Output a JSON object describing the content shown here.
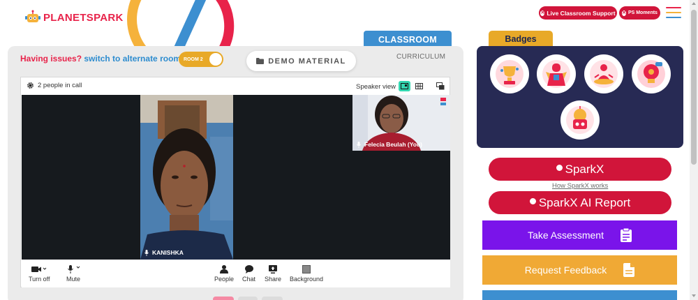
{
  "header": {
    "logo_text": "PLANETSPARK",
    "live_support_label": "Live Classroom Support",
    "moments_label": "PS Moments"
  },
  "tabs": {
    "classroom": "CLASSROOM",
    "curriculum": "CURRICULUM"
  },
  "classroom": {
    "issues_prefix": "Having issues?",
    "issues_link": "switch to alternate room",
    "room_toggle": "ROOM 2",
    "demo_material": "DEMO MATERIAL",
    "people_count": "2 people in call",
    "speaker_view": "Speaker view",
    "participants": [
      {
        "name": "KANISHKA"
      },
      {
        "name": "Felecia Beulah (You)"
      }
    ],
    "controls": {
      "turn_off": "Turn off",
      "mute": "Mute",
      "people": "People",
      "chat": "Chat",
      "share": "Share",
      "background": "Background"
    }
  },
  "badges": {
    "title": "Badges",
    "items": [
      "trophy-badge",
      "superhero-badge",
      "meditation-badge",
      "idea-badge",
      "robot-badge"
    ]
  },
  "actions": {
    "sparkx": "SparkX",
    "how_sparkx": "How SparkX works",
    "sparkx_report": "SparkX AI Report",
    "take_assessment": "Take Assessment",
    "request_feedback": "Request Feedback"
  },
  "colors": {
    "brand_red": "#d1153a",
    "brand_blue": "#3d8fd0",
    "brand_yellow": "#e8a928",
    "badge_panel": "#272a54",
    "assessment_purple": "#7a14ea",
    "feedback_orange": "#f0a935",
    "active_view": "#33d6b0"
  }
}
